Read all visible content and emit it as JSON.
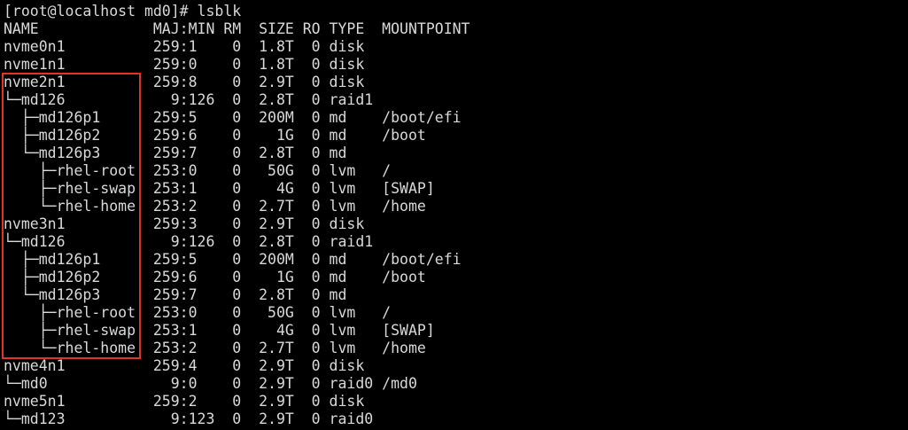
{
  "terminal": {
    "background": "#000000",
    "foreground": "#d9d9d9",
    "highlight_color": "#e0342b",
    "lines": [
      "[root@localhost md0]# lsblk",
      "NAME             MAJ:MIN RM  SIZE RO TYPE  MOUNTPOINT",
      "nvme0n1          259:1    0  1.8T  0 disk",
      "nvme1n1          259:0    0  1.8T  0 disk",
      "nvme2n1          259:8    0  2.9T  0 disk",
      "└─md126            9:126  0  2.8T  0 raid1",
      "  ├─md126p1      259:5    0  200M  0 md    /boot/efi",
      "  ├─md126p2      259:6    0    1G  0 md    /boot",
      "  └─md126p3      259:7    0  2.8T  0 md",
      "    ├─rhel-root  253:0    0   50G  0 lvm   /",
      "    ├─rhel-swap  253:1    0    4G  0 lvm   [SWAP]",
      "    └─rhel-home  253:2    0  2.7T  0 lvm   /home",
      "nvme3n1          259:3    0  2.9T  0 disk",
      "└─md126            9:126  0  2.8T  0 raid1",
      "  ├─md126p1      259:5    0  200M  0 md    /boot/efi",
      "  ├─md126p2      259:6    0    1G  0 md    /boot",
      "  └─md126p3      259:7    0  2.8T  0 md",
      "    ├─rhel-root  253:0    0   50G  0 lvm   /",
      "    ├─rhel-swap  253:1    0    4G  0 lvm   [SWAP]",
      "    └─rhel-home  253:2    0  2.7T  0 lvm   /home",
      "nvme4n1          259:4    0  2.9T  0 disk",
      "└─md0              9:0    0  2.9T  0 raid0 /md0",
      "nvme5n1          259:2    0  2.9T  0 disk",
      "└─md123            9:123  0  2.9T  0 raid0"
    ]
  }
}
